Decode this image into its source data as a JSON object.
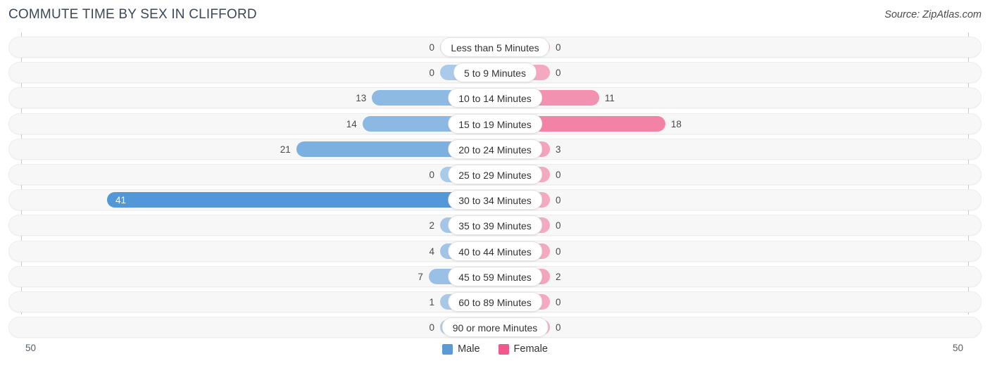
{
  "header": {
    "title": "COMMUTE TIME BY SEX IN CLIFFORD",
    "source": "Source: ZipAtlas.com"
  },
  "axis": {
    "left_tick": "50",
    "right_tick": "50"
  },
  "legend": {
    "items": [
      {
        "label": "Male",
        "color": "#5b9bd5"
      },
      {
        "label": "Female",
        "color": "#f2588b"
      }
    ]
  },
  "chart_data": {
    "type": "bar",
    "orientation": "horizontal-diverging",
    "title": "COMMUTE TIME BY SEX IN CLIFFORD",
    "xlabel": "",
    "ylabel": "",
    "xlim": [
      50,
      50
    ],
    "axis_left_max": 50,
    "axis_right_max": 50,
    "grid": false,
    "legend_position": "bottom-center",
    "categories": [
      "Less than 5 Minutes",
      "5 to 9 Minutes",
      "10 to 14 Minutes",
      "15 to 19 Minutes",
      "20 to 24 Minutes",
      "25 to 29 Minutes",
      "30 to 34 Minutes",
      "35 to 39 Minutes",
      "40 to 44 Minutes",
      "45 to 59 Minutes",
      "60 to 89 Minutes",
      "90 or more Minutes"
    ],
    "series": [
      {
        "name": "Male",
        "color": "#5b9bd5",
        "values": [
          0,
          0,
          13,
          14,
          21,
          0,
          41,
          2,
          4,
          7,
          1,
          0
        ]
      },
      {
        "name": "Female",
        "color": "#f2588b",
        "values": [
          0,
          0,
          11,
          18,
          3,
          0,
          0,
          0,
          0,
          2,
          0,
          0
        ]
      }
    ]
  },
  "rows": [
    {
      "label": "Less than 5 Minutes",
      "male": "0",
      "female": "0",
      "male_value": 0,
      "female_value": 0
    },
    {
      "label": "5 to 9 Minutes",
      "male": "0",
      "female": "0",
      "male_value": 0,
      "female_value": 0
    },
    {
      "label": "10 to 14 Minutes",
      "male": "13",
      "female": "11",
      "male_value": 13,
      "female_value": 11
    },
    {
      "label": "15 to 19 Minutes",
      "male": "14",
      "female": "18",
      "male_value": 14,
      "female_value": 18
    },
    {
      "label": "20 to 24 Minutes",
      "male": "21",
      "female": "3",
      "male_value": 21,
      "female_value": 3
    },
    {
      "label": "25 to 29 Minutes",
      "male": "0",
      "female": "0",
      "male_value": 0,
      "female_value": 0
    },
    {
      "label": "30 to 34 Minutes",
      "male": "41",
      "female": "0",
      "male_value": 41,
      "female_value": 0
    },
    {
      "label": "35 to 39 Minutes",
      "male": "2",
      "female": "0",
      "male_value": 2,
      "female_value": 0
    },
    {
      "label": "40 to 44 Minutes",
      "male": "4",
      "female": "0",
      "male_value": 4,
      "female_value": 0
    },
    {
      "label": "45 to 59 Minutes",
      "male": "7",
      "female": "2",
      "male_value": 7,
      "female_value": 2
    },
    {
      "label": "60 to 89 Minutes",
      "male": "1",
      "female": "0",
      "male_value": 1,
      "female_value": 0
    },
    {
      "label": "90 or more Minutes",
      "male": "0",
      "female": "0",
      "male_value": 0,
      "female_value": 0
    }
  ]
}
